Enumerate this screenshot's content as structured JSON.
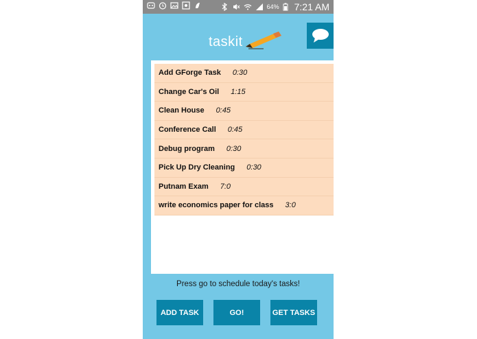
{
  "status_bar": {
    "battery": "64%",
    "time": "7:21 AM"
  },
  "header": {
    "logo_task": "task",
    "logo_it": "it"
  },
  "tasks": [
    {
      "name": "Add GForge Task",
      "time": "0:30"
    },
    {
      "name": "Change Car's Oil",
      "time": "1:15"
    },
    {
      "name": "Clean House",
      "time": "0:45"
    },
    {
      "name": "Conference Call",
      "time": "0:45"
    },
    {
      "name": "Debug program",
      "time": "0:30"
    },
    {
      "name": "Pick Up Dry Cleaning",
      "time": "0:30"
    },
    {
      "name": "Putnam Exam",
      "time": "7:0"
    },
    {
      "name": "write economics paper for class",
      "time": "3:0"
    }
  ],
  "hint": "Press go to schedule today's tasks!",
  "buttons": {
    "add_task": "ADD TASK",
    "go": "GO!",
    "get_tasks": "GET TASKS"
  },
  "colors": {
    "background": "#74c8e6",
    "accent": "#0a84a8",
    "task_row": "#fddcbf"
  },
  "icons": [
    "chat-bubble-icon",
    "pencil-icon",
    "wifi-icon",
    "signal-icon",
    "bluetooth-icon",
    "alarm-icon",
    "mute-icon"
  ]
}
